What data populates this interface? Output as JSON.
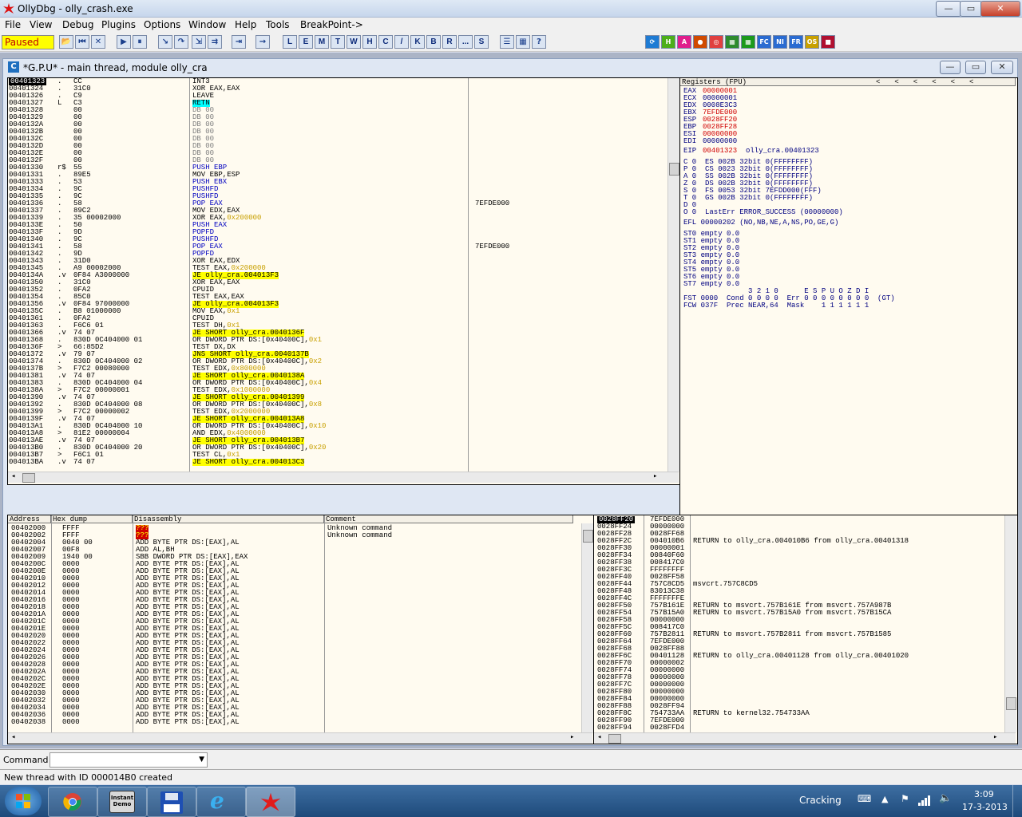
{
  "window": {
    "title": "OllyDbg - olly_crash.exe",
    "controls": {
      "minimize": "—",
      "maximize": "▭",
      "close": "✕"
    }
  },
  "menubar": [
    "File",
    "View",
    "Debug",
    "Plugins",
    "Options",
    "Window",
    "Help",
    "Tools",
    "BreakPoint->"
  ],
  "toolbar": {
    "status": "Paused",
    "buttons": [
      "open-icon",
      "restart-icon",
      "close-icon",
      "run-icon",
      "pause-icon",
      "step-into-icon",
      "step-over-icon",
      "trace-into-icon",
      "trace-over-icon",
      "execute-till-return-icon",
      "go-to-icon"
    ],
    "window_letters": [
      "L",
      "E",
      "M",
      "T",
      "W",
      "H",
      "C",
      "/",
      "K",
      "B",
      "R",
      "...",
      "S"
    ],
    "extra_buttons": [
      "list-icon",
      "colors-icon",
      "help-icon"
    ],
    "plugin_buttons": [
      "refresh-icon",
      "h-icon",
      "a-icon",
      "bp-icon",
      "target-icon",
      "grid-icon",
      "net-icon",
      "fc-icon",
      "ni-icon",
      "fr-icon",
      "os-icon",
      "red-icon"
    ]
  },
  "cpu_window": {
    "title": "*G.P.U* - main thread, module olly_cra",
    "icon_letter": "C"
  },
  "disasm": {
    "rows": [
      [
        "00401323",
        ".",
        "CC",
        "INT3",
        ""
      ],
      [
        "00401324",
        ".",
        "31C0",
        "XOR EAX,EAX",
        ""
      ],
      [
        "00401326",
        ".",
        "C9",
        "LEAVE",
        ""
      ],
      [
        "00401327",
        "L",
        "C3",
        "RETN",
        ""
      ],
      [
        "00401328",
        "",
        "00",
        "DB 00",
        ""
      ],
      [
        "00401329",
        "",
        "00",
        "DB 00",
        ""
      ],
      [
        "0040132A",
        "",
        "00",
        "DB 00",
        ""
      ],
      [
        "0040132B",
        "",
        "00",
        "DB 00",
        ""
      ],
      [
        "0040132C",
        "",
        "00",
        "DB 00",
        ""
      ],
      [
        "0040132D",
        "",
        "00",
        "DB 00",
        ""
      ],
      [
        "0040132E",
        "",
        "00",
        "DB 00",
        ""
      ],
      [
        "0040132F",
        "",
        "00",
        "DB 00",
        ""
      ],
      [
        "00401330",
        "r$",
        "55",
        "PUSH EBP",
        ""
      ],
      [
        "00401331",
        ".",
        "89E5",
        "MOV EBP,ESP",
        ""
      ],
      [
        "00401333",
        ".",
        "53",
        "PUSH EBX",
        ""
      ],
      [
        "00401334",
        ".",
        "9C",
        "PUSHFD",
        ""
      ],
      [
        "00401335",
        ".",
        "9C",
        "PUSHFD",
        ""
      ],
      [
        "00401336",
        ".",
        "58",
        "POP EAX",
        "7EFDE000"
      ],
      [
        "00401337",
        ".",
        "89C2",
        "MOV EDX,EAX",
        ""
      ],
      [
        "00401339",
        ".",
        "35 00002000",
        "XOR EAX,0x200000",
        ""
      ],
      [
        "0040133E",
        ".",
        "50",
        "PUSH EAX",
        ""
      ],
      [
        "0040133F",
        ".",
        "9D",
        "POPFD",
        ""
      ],
      [
        "00401340",
        ".",
        "9C",
        "PUSHFD",
        ""
      ],
      [
        "00401341",
        ".",
        "58",
        "POP EAX",
        "7EFDE000"
      ],
      [
        "00401342",
        ".",
        "9D",
        "POPFD",
        ""
      ],
      [
        "00401343",
        ".",
        "31D0",
        "XOR EAX,EDX",
        ""
      ],
      [
        "00401345",
        ".",
        "A9 00002000",
        "TEST EAX,0x200000",
        ""
      ],
      [
        "0040134A",
        ".v",
        "0F84 A3000000",
        "JE olly_cra.004013F3",
        ""
      ],
      [
        "00401350",
        ".",
        "31C0",
        "XOR EAX,EAX",
        ""
      ],
      [
        "00401352",
        ".",
        "0FA2",
        "CPUID",
        ""
      ],
      [
        "00401354",
        ".",
        "85C0",
        "TEST EAX,EAX",
        ""
      ],
      [
        "00401356",
        ".v",
        "0F84 97000000",
        "JE olly_cra.004013F3",
        ""
      ],
      [
        "0040135C",
        ".",
        "B8 01000000",
        "MOV EAX,0x1",
        ""
      ],
      [
        "00401361",
        ".",
        "0FA2",
        "CPUID",
        ""
      ],
      [
        "00401363",
        ".",
        "F6C6 01",
        "TEST DH,0x1",
        ""
      ],
      [
        "00401366",
        ".v",
        "74 07",
        "JE SHORT olly_cra.0040136F",
        ""
      ],
      [
        "00401368",
        ".",
        "830D 0C404000 01",
        "OR DWORD PTR DS:[0x40400C],0x1",
        ""
      ],
      [
        "0040136F",
        ">",
        "66:85D2",
        "TEST DX,DX",
        ""
      ],
      [
        "00401372",
        ".v",
        "79 07",
        "JNS SHORT olly_cra.0040137B",
        ""
      ],
      [
        "00401374",
        ".",
        "830D 0C404000 02",
        "OR DWORD PTR DS:[0x40400C],0x2",
        ""
      ],
      [
        "0040137B",
        ">",
        "F7C2 00080000",
        "TEST EDX,0x800000",
        ""
      ],
      [
        "00401381",
        ".v",
        "74 07",
        "JE SHORT olly_cra.0040138A",
        ""
      ],
      [
        "00401383",
        ".",
        "830D 0C404000 04",
        "OR DWORD PTR DS:[0x40400C],0x4",
        ""
      ],
      [
        "0040138A",
        ">",
        "F7C2 00000001",
        "TEST EDX,0x1000000",
        ""
      ],
      [
        "00401390",
        ".v",
        "74 07",
        "JE SHORT olly_cra.00401399",
        ""
      ],
      [
        "00401392",
        ".",
        "830D 0C404000 08",
        "OR DWORD PTR DS:[0x40400C],0x8",
        ""
      ],
      [
        "00401399",
        ">",
        "F7C2 00000002",
        "TEST EDX,0x2000000",
        ""
      ],
      [
        "0040139F",
        ".v",
        "74 07",
        "JE SHORT olly_cra.004013A8",
        ""
      ],
      [
        "004013A1",
        ".",
        "830D 0C404000 10",
        "OR DWORD PTR DS:[0x40400C],0x10",
        ""
      ],
      [
        "004013A8",
        ">",
        "81E2 00000004",
        "AND EDX,0x4000000",
        ""
      ],
      [
        "004013AE",
        ".v",
        "74 07",
        "JE SHORT olly_cra.004013B7",
        ""
      ],
      [
        "004013B0",
        ".",
        "830D 0C404000 20",
        "OR DWORD PTR DS:[0x40400C],0x20",
        ""
      ],
      [
        "004013B7",
        ">",
        "F6C1 01",
        "TEST CL,0x1",
        ""
      ],
      [
        "004013BA",
        ".v",
        "74 07",
        "JE SHORT olly_cra.004013C3",
        ""
      ]
    ]
  },
  "registers": {
    "header": "Registers (FPU)",
    "gp": [
      [
        "EAX",
        "00000001",
        true
      ],
      [
        "ECX",
        "00000001",
        false
      ],
      [
        "EDX",
        "0008E3C3",
        false
      ],
      [
        "EBX",
        "7EFDE000",
        true
      ],
      [
        "ESP",
        "0028FF20",
        true
      ],
      [
        "EBP",
        "0028FF28",
        true
      ],
      [
        "ESI",
        "00000000",
        true
      ],
      [
        "EDI",
        "00000000",
        false
      ]
    ],
    "eip": [
      "EIP",
      "00401323",
      "olly_cra.00401323"
    ],
    "flags": [
      "C 0  ES 002B 32bit 0(FFFFFFFF)",
      "P 0  CS 0023 32bit 0(FFFFFFFF)",
      "A 0  SS 002B 32bit 0(FFFFFFFF)",
      "Z 0  DS 002B 32bit 0(FFFFFFFF)",
      "S 0  FS 0053 32bit 7EFDD000(FFF)",
      "T 0  GS 002B 32bit 0(FFFFFFFF)",
      "D 0",
      "O 0  LastErr ERROR_SUCCESS (00000000)"
    ],
    "efl": "EFL 00000202 (NO,NB,NE,A,NS,PO,GE,G)",
    "fpu": [
      "ST0 empty 0.0",
      "ST1 empty 0.0",
      "ST2 empty 0.0",
      "ST3 empty 0.0",
      "ST4 empty 0.0",
      "ST5 empty 0.0",
      "ST6 empty 0.0",
      "ST7 empty 0.0"
    ],
    "fpu_tail": [
      "               3 2 1 0      E S P U O Z D I",
      "FST 0000  Cond 0 0 0 0  Err 0 0 0 0 0 0 0 0  (GT)",
      "FCW 037F  Prec NEAR,64  Mask    1 1 1 1 1 1"
    ]
  },
  "dump": {
    "headers": [
      "Address",
      "Hex dump",
      "Disassembly",
      "Comment"
    ],
    "rows": [
      [
        "00402000",
        "FFFF",
        "???",
        "Unknown command"
      ],
      [
        "00402002",
        "FFFF",
        "???",
        "Unknown command"
      ],
      [
        "00402004",
        "0040 00",
        "ADD BYTE PTR DS:[EAX],AL",
        ""
      ],
      [
        "00402007",
        "00F8",
        "ADD AL,BH",
        ""
      ],
      [
        "00402009",
        "1940 00",
        "SBB DWORD PTR DS:[EAX],EAX",
        ""
      ],
      [
        "0040200C",
        "0000",
        "ADD BYTE PTR DS:[EAX],AL",
        ""
      ],
      [
        "0040200E",
        "0000",
        "ADD BYTE PTR DS:[EAX],AL",
        ""
      ],
      [
        "00402010",
        "0000",
        "ADD BYTE PTR DS:[EAX],AL",
        ""
      ],
      [
        "00402012",
        "0000",
        "ADD BYTE PTR DS:[EAX],AL",
        ""
      ],
      [
        "00402014",
        "0000",
        "ADD BYTE PTR DS:[EAX],AL",
        ""
      ],
      [
        "00402016",
        "0000",
        "ADD BYTE PTR DS:[EAX],AL",
        ""
      ],
      [
        "00402018",
        "0000",
        "ADD BYTE PTR DS:[EAX],AL",
        ""
      ],
      [
        "0040201A",
        "0000",
        "ADD BYTE PTR DS:[EAX],AL",
        ""
      ],
      [
        "0040201C",
        "0000",
        "ADD BYTE PTR DS:[EAX],AL",
        ""
      ],
      [
        "0040201E",
        "0000",
        "ADD BYTE PTR DS:[EAX],AL",
        ""
      ],
      [
        "00402020",
        "0000",
        "ADD BYTE PTR DS:[EAX],AL",
        ""
      ],
      [
        "00402022",
        "0000",
        "ADD BYTE PTR DS:[EAX],AL",
        ""
      ],
      [
        "00402024",
        "0000",
        "ADD BYTE PTR DS:[EAX],AL",
        ""
      ],
      [
        "00402026",
        "0000",
        "ADD BYTE PTR DS:[EAX],AL",
        ""
      ],
      [
        "00402028",
        "0000",
        "ADD BYTE PTR DS:[EAX],AL",
        ""
      ],
      [
        "0040202A",
        "0000",
        "ADD BYTE PTR DS:[EAX],AL",
        ""
      ],
      [
        "0040202C",
        "0000",
        "ADD BYTE PTR DS:[EAX],AL",
        ""
      ],
      [
        "0040202E",
        "0000",
        "ADD BYTE PTR DS:[EAX],AL",
        ""
      ],
      [
        "00402030",
        "0000",
        "ADD BYTE PTR DS:[EAX],AL",
        ""
      ],
      [
        "00402032",
        "0000",
        "ADD BYTE PTR DS:[EAX],AL",
        ""
      ],
      [
        "00402034",
        "0000",
        "ADD BYTE PTR DS:[EAX],AL",
        ""
      ],
      [
        "00402036",
        "0000",
        "ADD BYTE PTR DS:[EAX],AL",
        ""
      ],
      [
        "00402038",
        "0000",
        "ADD BYTE PTR DS:[EAX],AL",
        ""
      ]
    ]
  },
  "stack": {
    "rows": [
      [
        "0028FF20",
        "7EFDE000",
        ""
      ],
      [
        "0028FF24",
        "00000000",
        ""
      ],
      [
        "0028FF28",
        "0028FF68",
        ""
      ],
      [
        "0028FF2C",
        "004010B6",
        "RETURN to olly_cra.004010B6 from olly_cra.00401318"
      ],
      [
        "0028FF30",
        "00000001",
        ""
      ],
      [
        "0028FF34",
        "00840F60",
        ""
      ],
      [
        "0028FF38",
        "008417C0",
        ""
      ],
      [
        "0028FF3C",
        "FFFFFFFF",
        ""
      ],
      [
        "0028FF40",
        "0028FF58",
        ""
      ],
      [
        "0028FF44",
        "757C8CD5",
        "msvcrt.757C8CD5"
      ],
      [
        "0028FF48",
        "83013C38",
        ""
      ],
      [
        "0028FF4C",
        "FFFFFFFE",
        ""
      ],
      [
        "0028FF50",
        "757B161E",
        "RETURN to msvcrt.757B161E from msvcrt.757A987B"
      ],
      [
        "0028FF54",
        "757B15A0",
        "RETURN to msvcrt.757B15A0 from msvcrt.757B15CA"
      ],
      [
        "0028FF58",
        "00000000",
        ""
      ],
      [
        "0028FF5C",
        "008417C0",
        ""
      ],
      [
        "0028FF60",
        "757B2811",
        "RETURN to msvcrt.757B2811 from msvcrt.757B1585"
      ],
      [
        "0028FF64",
        "7EFDE000",
        ""
      ],
      [
        "0028FF68",
        "0028FF88",
        ""
      ],
      [
        "0028FF6C",
        "00401128",
        "RETURN to olly_cra.00401128 from olly_cra.00401020"
      ],
      [
        "0028FF70",
        "00000002",
        ""
      ],
      [
        "0028FF74",
        "00000000",
        ""
      ],
      [
        "0028FF78",
        "00000000",
        ""
      ],
      [
        "0028FF7C",
        "00000000",
        ""
      ],
      [
        "0028FF80",
        "00000000",
        ""
      ],
      [
        "0028FF84",
        "00000000",
        ""
      ],
      [
        "0028FF88",
        "0028FF94",
        ""
      ],
      [
        "0028FF8C",
        "754733AA",
        "RETURN to kernel32.754733AA"
      ],
      [
        "0028FF90",
        "7EFDE000",
        ""
      ],
      [
        "0028FF94",
        "0028FFD4",
        ""
      ]
    ]
  },
  "command": {
    "label": "Command :",
    "value": ""
  },
  "status": "New thread with ID 000014B0 created",
  "taskbar": {
    "apps": [
      "chrome-icon",
      "instant-demo-icon",
      "floppy-icon",
      "ie-icon",
      "ollydbg-icon"
    ],
    "instant_demo_label": "Instant Demo",
    "tray_label": "Cracking",
    "time": "3:09",
    "date": "17-3-2013"
  },
  "colors": {
    "yellow": "#ffff00",
    "cyan": "#00ffff",
    "red": "#d00000",
    "pane_bg": "#fffbf0"
  }
}
